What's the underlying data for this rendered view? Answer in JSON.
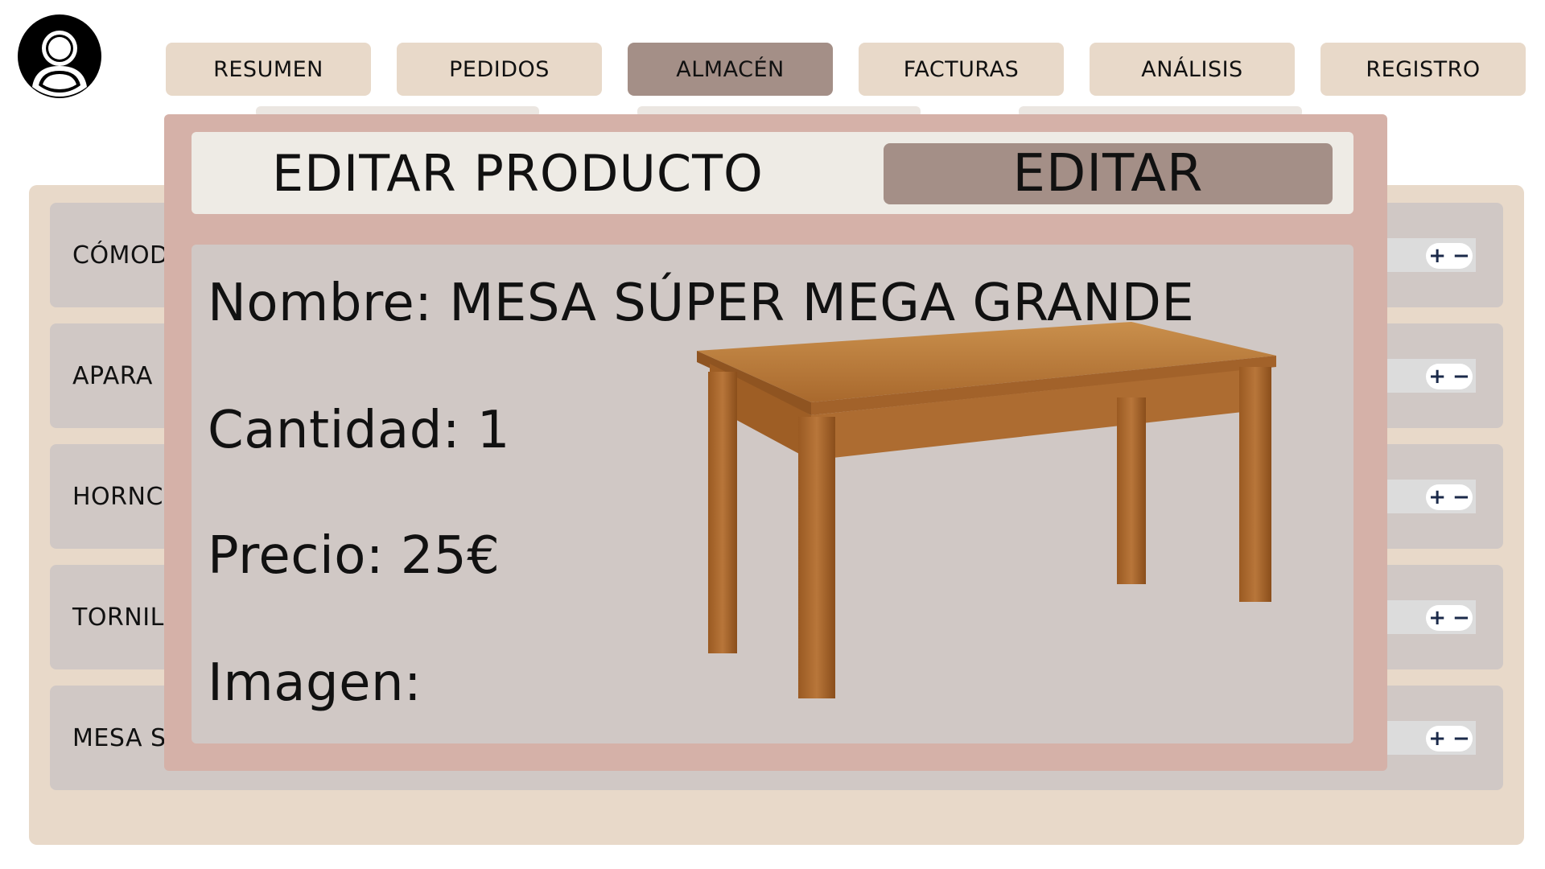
{
  "header": {
    "avatar_icon": "user-icon",
    "tabs": [
      {
        "label": "RESUMEN",
        "active": false
      },
      {
        "label": "PEDIDOS",
        "active": false
      },
      {
        "label": "ALMACÉN",
        "active": true
      },
      {
        "label": "FACTURAS",
        "active": false
      },
      {
        "label": "ANÁLISIS",
        "active": false
      },
      {
        "label": "REGISTRO",
        "active": false
      }
    ]
  },
  "inventory": {
    "items": [
      {
        "label": "CÓMOD"
      },
      {
        "label": "APARA"
      },
      {
        "label": "HORNC"
      },
      {
        "label": "TORNIL"
      },
      {
        "label": "MESA S"
      }
    ],
    "stepper": {
      "plus": "+",
      "minus": "−"
    }
  },
  "modal": {
    "title": "EDITAR PRODUCTO",
    "edit_button": "EDITAR",
    "fields": {
      "name": "Nombre: MESA SÚPER MEGA GRANDE",
      "quantity": "Cantidad: 1",
      "price": "Precio: 25€",
      "image": "Imagen:"
    }
  },
  "colors": {
    "tab_bg": "#e8d9c9",
    "tab_active": "#a48f87",
    "modal_bg": "#d5b1a8",
    "row_bg": "#d0c8c5"
  }
}
